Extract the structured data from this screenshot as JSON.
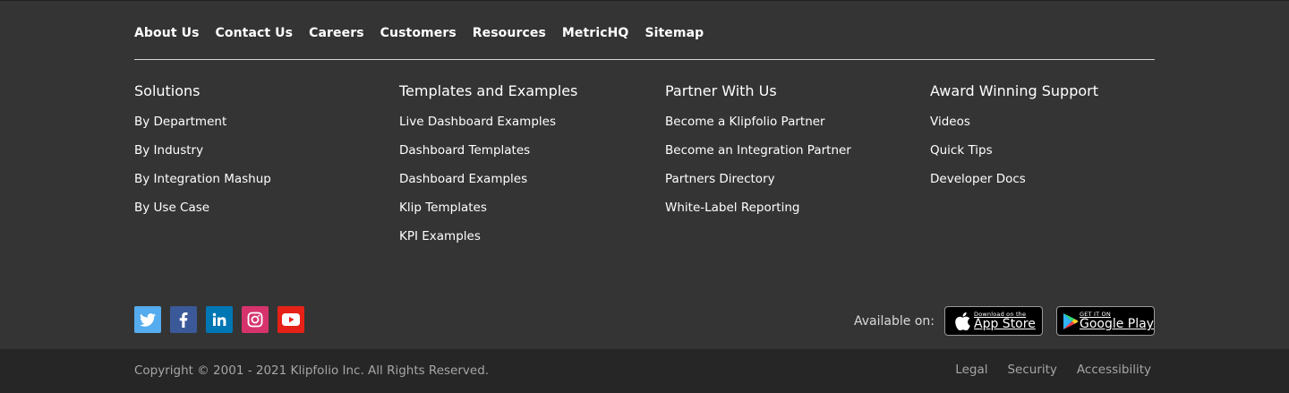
{
  "topnav": {
    "items": [
      "About Us",
      "Contact Us",
      "Careers",
      "Customers",
      "Resources",
      "MetricHQ",
      "Sitemap"
    ]
  },
  "columns": [
    {
      "heading": "Solutions",
      "links": [
        "By Department",
        "By Industry",
        "By Integration Mashup",
        "By Use Case"
      ]
    },
    {
      "heading": "Templates and Examples",
      "links": [
        "Live Dashboard Examples",
        "Dashboard Templates",
        "Dashboard Examples",
        "Klip Templates",
        "KPI Examples"
      ]
    },
    {
      "heading": "Partner With Us",
      "links": [
        "Become a Klipfolio Partner",
        "Become an Integration Partner",
        "Partners Directory",
        "White-Label Reporting"
      ]
    },
    {
      "heading": "Award Winning Support",
      "links": [
        "Videos",
        "Quick Tips",
        "Developer Docs"
      ]
    }
  ],
  "social": [
    {
      "icon": "twitter-icon",
      "color": "#55acee"
    },
    {
      "icon": "facebook-icon",
      "color": "#3b5998"
    },
    {
      "icon": "linkedin-icon",
      "color": "#0077b5"
    },
    {
      "icon": "instagram-icon",
      "color": "#d6336c"
    },
    {
      "icon": "youtube-icon",
      "color": "#e62117"
    }
  ],
  "apps": {
    "available_label": "Available on:",
    "apple_small": "Download on the",
    "apple_big": "App Store",
    "google_small": "GET IT ON",
    "google_big": "Google Play"
  },
  "bottom": {
    "copyright": "Copyright © 2001 - 2021 Klipfolio Inc.  All Rights Reserved.",
    "links": [
      "Legal",
      "Security",
      "Accessibility"
    ]
  }
}
